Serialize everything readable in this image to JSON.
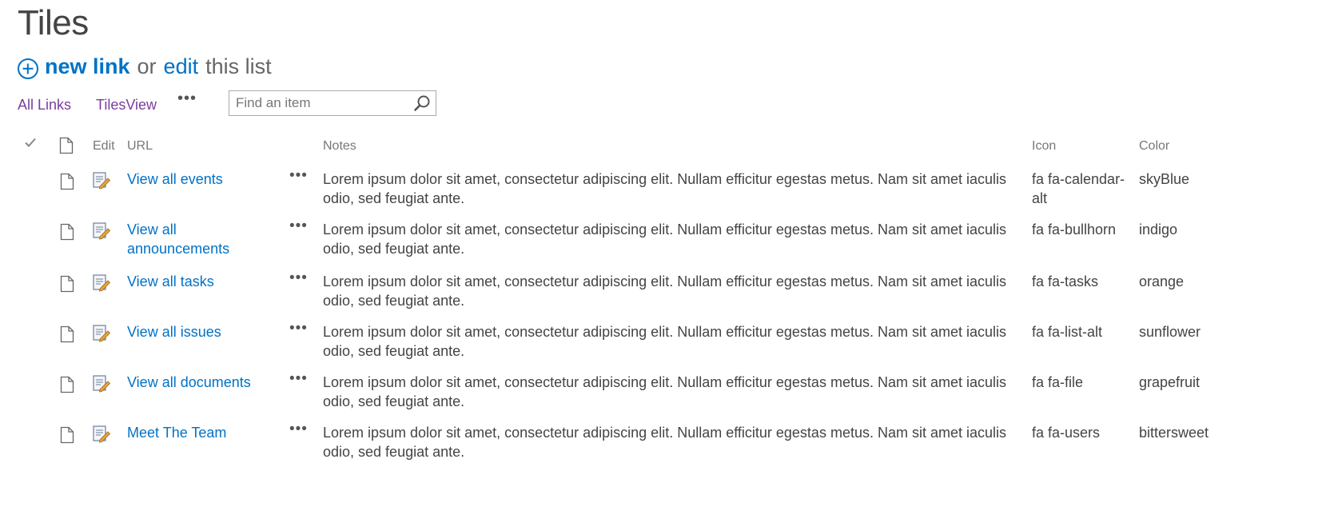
{
  "page": {
    "title": "Tiles"
  },
  "actions": {
    "new_link": "new link",
    "or": "or",
    "edit": "edit",
    "this_list": "this list"
  },
  "views": {
    "all_links": "All Links",
    "tiles_view": "TilesView",
    "more": "•••"
  },
  "search": {
    "placeholder": "Find an item"
  },
  "columns": {
    "edit": "Edit",
    "url": "URL",
    "notes": "Notes",
    "icon": "Icon",
    "color": "Color"
  },
  "rows": [
    {
      "url": "View all events",
      "more": "•••",
      "notes": "Lorem ipsum dolor sit amet, consectetur adipiscing elit. Nullam efficitur egestas metus. Nam sit amet iaculis odio, sed feugiat ante.",
      "icon": "fa fa-calendar-alt",
      "color": "skyBlue"
    },
    {
      "url": "View all announcements",
      "more": "•••",
      "notes": "Lorem ipsum dolor sit amet, consectetur adipiscing elit. Nullam efficitur egestas metus. Nam sit amet iaculis odio, sed feugiat ante.",
      "icon": "fa fa-bullhorn",
      "color": "indigo"
    },
    {
      "url": "View all tasks",
      "more": "•••",
      "notes": "Lorem ipsum dolor sit amet, consectetur adipiscing elit. Nullam efficitur egestas metus. Nam sit amet iaculis odio, sed feugiat ante.",
      "icon": "fa fa-tasks",
      "color": "orange"
    },
    {
      "url": "View all issues",
      "more": "•••",
      "notes": "Lorem ipsum dolor sit amet, consectetur adipiscing elit. Nullam efficitur egestas metus. Nam sit amet iaculis odio, sed feugiat ante.",
      "icon": "fa fa-list-alt",
      "color": "sunflower"
    },
    {
      "url": "View all documents",
      "more": "•••",
      "notes": "Lorem ipsum dolor sit amet, consectetur adipiscing elit. Nullam efficitur egestas metus. Nam sit amet iaculis odio, sed feugiat ante.",
      "icon": "fa fa-file",
      "color": "grapefruit"
    },
    {
      "url": "Meet The Team",
      "more": "•••",
      "notes": "Lorem ipsum dolor sit amet, consectetur adipiscing elit. Nullam efficitur egestas metus. Nam sit amet iaculis odio, sed feugiat ante.",
      "icon": "fa fa-users",
      "color": "bittersweet"
    }
  ]
}
